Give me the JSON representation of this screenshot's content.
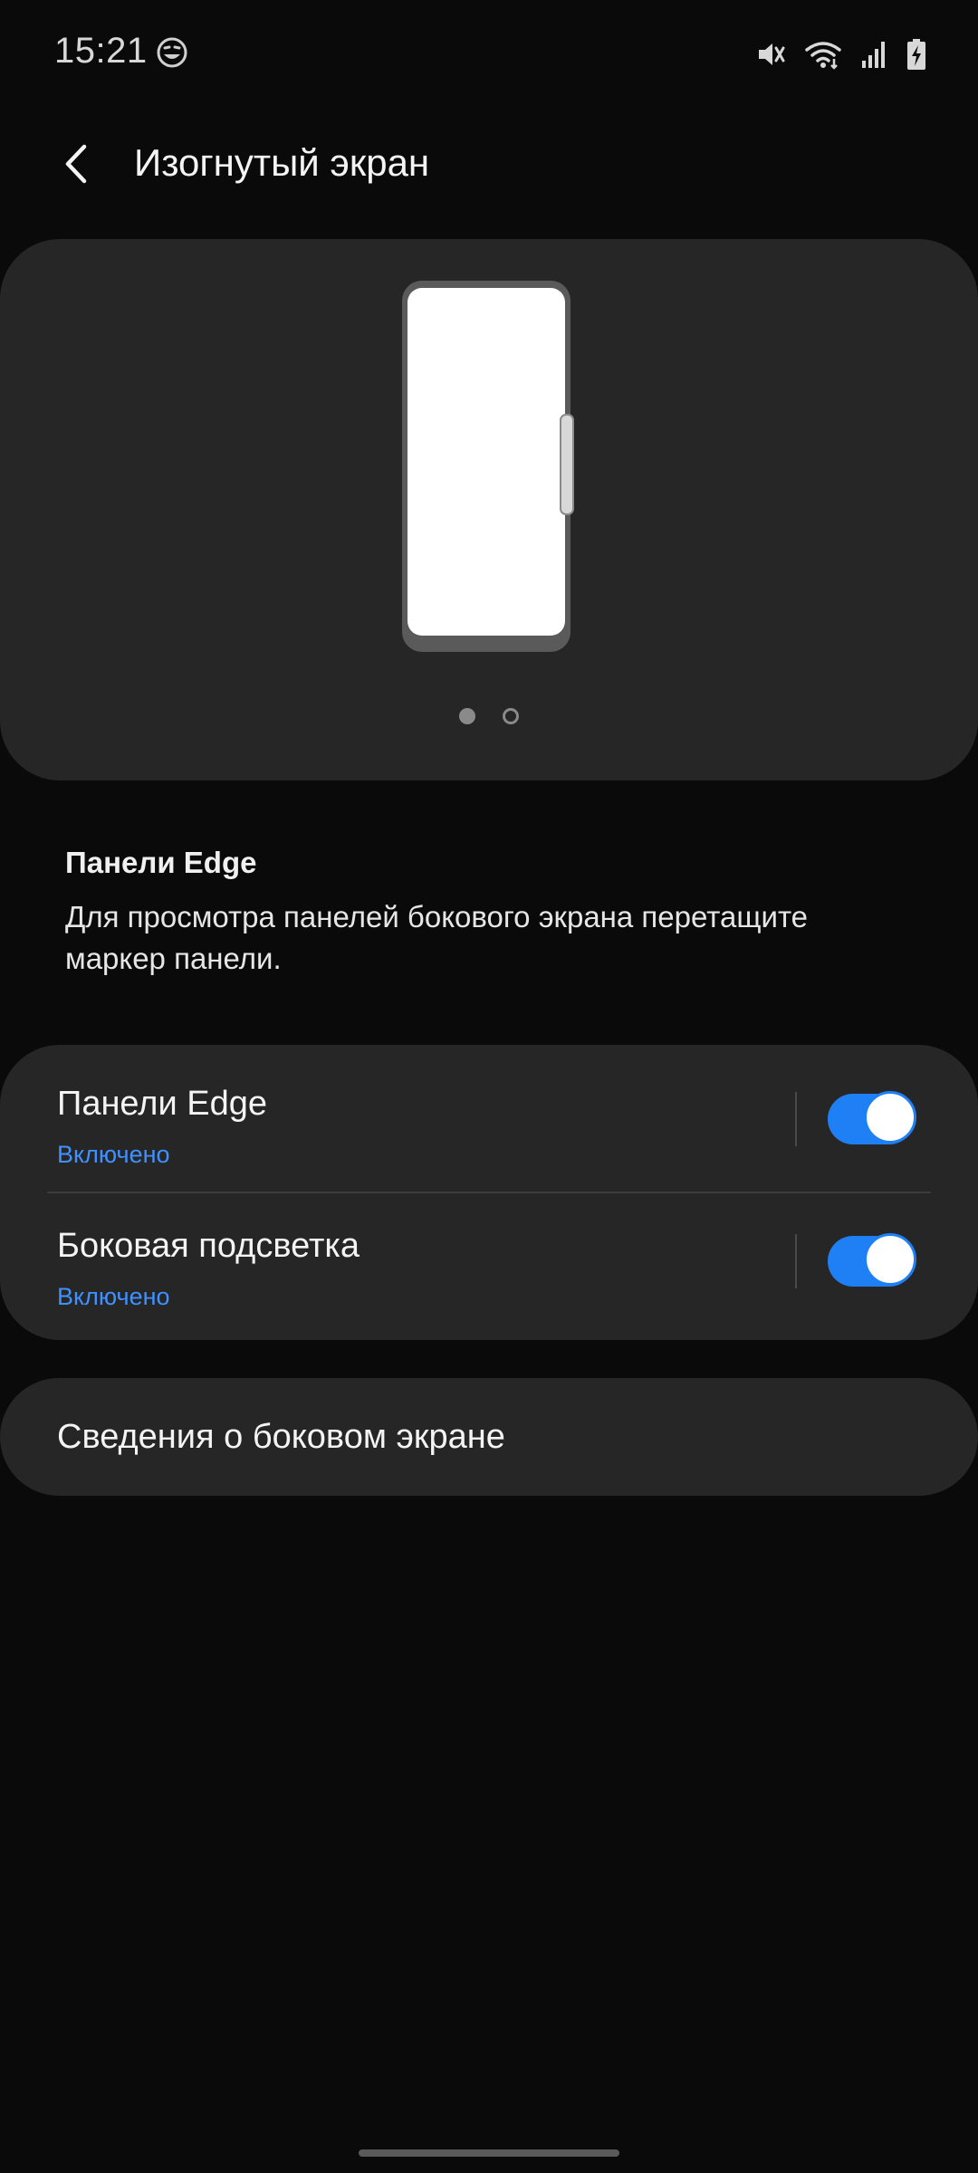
{
  "status_bar": {
    "time": "15:21",
    "icons": [
      "face-emoji-icon",
      "mute-icon",
      "wifi-icon",
      "signal-icon",
      "battery-charging-icon"
    ]
  },
  "app_bar": {
    "back_icon": "back-arrow-icon",
    "title": "Изогнутый экран"
  },
  "preview": {
    "page_count": 2,
    "active_page": 1
  },
  "description": {
    "title": "Панели Edge",
    "text": "Для просмотра панелей бокового экрана перетащите маркер панели."
  },
  "settings": {
    "items": [
      {
        "label": "Панели Edge",
        "status": "Включено",
        "enabled": true
      },
      {
        "label": "Боковая подсветка",
        "status": "Включено",
        "enabled": true
      }
    ]
  },
  "info": {
    "label": "Сведения о боковом экране"
  },
  "colors": {
    "background": "#0a0a0a",
    "card": "#262626",
    "accent": "#1f80f5",
    "status_text": "#3e91ff"
  }
}
